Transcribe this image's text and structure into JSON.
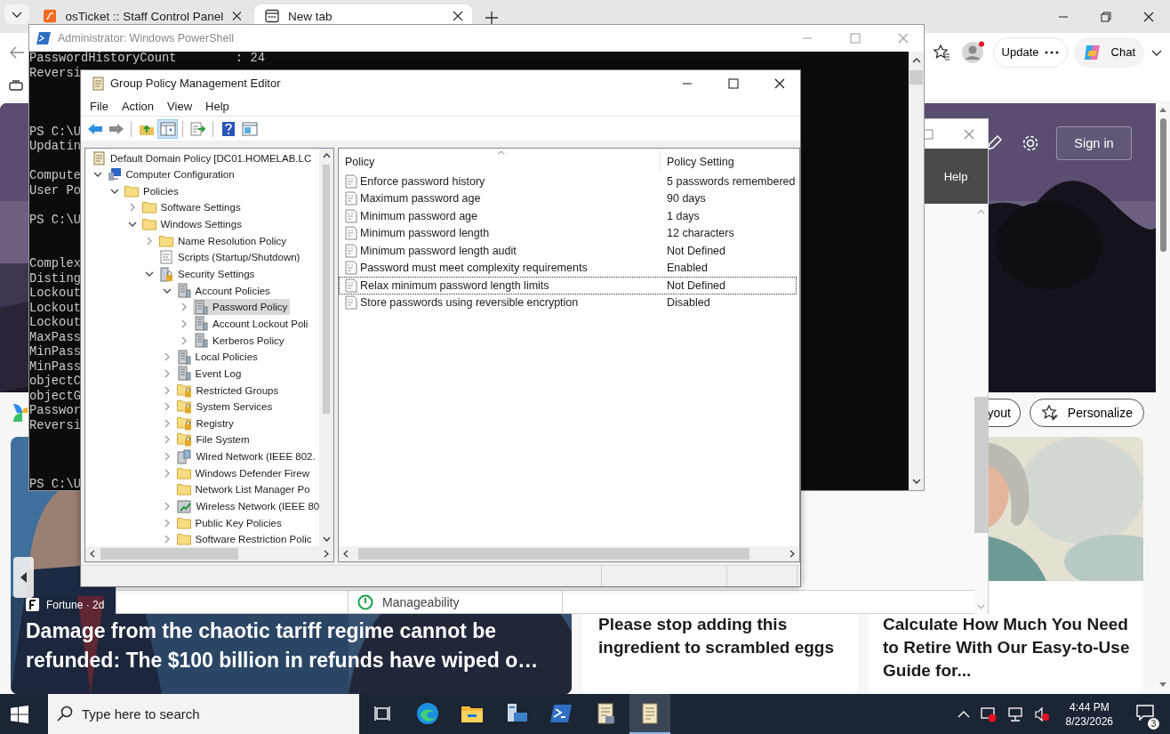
{
  "browser": {
    "tabs": [
      {
        "title": "osTicket :: Staff Control Panel",
        "selected": false
      },
      {
        "title": "New tab",
        "selected": true
      }
    ],
    "update_button": "Update",
    "chat_button": "Chat",
    "sign_in": "Sign in",
    "layout_button": "yout",
    "personalize_button": "Personalize",
    "cards": [
      {
        "kind": "photo-story",
        "source": "Fortune · 2d",
        "headline": "Damage from the chaotic tariff regime cannot be refunded: The $100 billion in refunds have wiped o…"
      },
      {
        "kind": "text-story",
        "headline": "Please stop adding this ingredient to scrambled eggs"
      },
      {
        "kind": "portrait-story",
        "headline": "Calculate How Much You Need to Retire With Our Easy-to-Use Guide for..."
      }
    ]
  },
  "background_window": {
    "menu_item": "Help",
    "row_label": "Manageability"
  },
  "powershell": {
    "title": "Administrator: Windows PowerShell",
    "blocks": [
      [
        "PasswordHistoryCount        : 24",
        "Reversi"
      ],
      [
        "PS C:\\U",
        "Updatin"
      ],
      [
        "Compute",
        "User Po"
      ],
      [
        "PS C:\\U"
      ],
      [
        "Complex",
        "Disting",
        "Lockout",
        "Lockout",
        "Lockout",
        "MaxPass",
        "MinPass",
        "MinPass",
        "objectC",
        "objectG",
        "Passwor",
        "Reversi"
      ],
      [
        "PS C:\\U"
      ]
    ]
  },
  "gpme": {
    "title": "Group Policy Management Editor",
    "menu": [
      "File",
      "Action",
      "View",
      "Help"
    ],
    "toolbar": [
      {
        "kind": "back",
        "pressed": false
      },
      {
        "kind": "forward",
        "pressed": false
      },
      {
        "kind": "up",
        "pressed": false
      },
      {
        "kind": "tree",
        "pressed": true
      },
      {
        "kind": "export",
        "pressed": false
      },
      {
        "kind": "help",
        "pressed": false
      },
      {
        "kind": "properties",
        "pressed": false
      }
    ],
    "tree": [
      {
        "label": "Default Domain Policy [DC01.HOMELAB.LC",
        "kind": "scroll",
        "selected": false,
        "children": [
          {
            "label": "Computer Configuration",
            "kind": "computer",
            "expanded": true,
            "selected": false,
            "children": [
              {
                "label": "Policies",
                "kind": "folder",
                "expanded": true,
                "selected": false,
                "children": [
                  {
                    "label": "Software Settings",
                    "kind": "folder",
                    "expanded": false,
                    "selected": false
                  },
                  {
                    "label": "Windows Settings",
                    "kind": "folder",
                    "expanded": true,
                    "selected": false,
                    "children": [
                      {
                        "label": "Name Resolution Policy",
                        "kind": "folder",
                        "expanded": false,
                        "selected": false
                      },
                      {
                        "label": "Scripts (Startup/Shutdown)",
                        "kind": "script",
                        "selected": false
                      },
                      {
                        "label": "Security Settings",
                        "kind": "security",
                        "expanded": true,
                        "selected": false,
                        "children": [
                          {
                            "label": "Account Policies",
                            "kind": "server",
                            "expanded": true,
                            "selected": false,
                            "children": [
                              {
                                "label": "Password Policy",
                                "kind": "server",
                                "expanded": false,
                                "selected": true
                              },
                              {
                                "label": "Account Lockout Poli",
                                "kind": "server",
                                "expanded": false,
                                "selected": false
                              },
                              {
                                "label": "Kerberos Policy",
                                "kind": "server",
                                "expanded": false,
                                "selected": false
                              }
                            ]
                          },
                          {
                            "label": "Local Policies",
                            "kind": "server",
                            "expanded": false,
                            "selected": false
                          },
                          {
                            "label": "Event Log",
                            "kind": "server",
                            "expanded": false,
                            "selected": false
                          },
                          {
                            "label": "Restricted Groups",
                            "kind": "folder-lock",
                            "expanded": false,
                            "selected": false
                          },
                          {
                            "label": "System Services",
                            "kind": "folder-lock",
                            "expanded": false,
                            "selected": false
                          },
                          {
                            "label": "Registry",
                            "kind": "folder-lock",
                            "expanded": false,
                            "selected": false
                          },
                          {
                            "label": "File System",
                            "kind": "folder-lock",
                            "expanded": false,
                            "selected": false
                          },
                          {
                            "label": "Wired Network (IEEE 802.",
                            "kind": "network",
                            "expanded": false,
                            "selected": false
                          },
                          {
                            "label": "Windows Defender Firew",
                            "kind": "folder",
                            "expanded": false,
                            "selected": false
                          },
                          {
                            "label": "Network List Manager Po",
                            "kind": "folder",
                            "selected": false
                          },
                          {
                            "label": "Wireless Network (IEEE 80",
                            "kind": "wireless",
                            "expanded": false,
                            "selected": false
                          },
                          {
                            "label": "Public Key Policies",
                            "kind": "folder",
                            "expanded": false,
                            "selected": false
                          },
                          {
                            "label": "Software Restriction Polic",
                            "kind": "folder",
                            "expanded": false,
                            "selected": false
                          }
                        ]
                      }
                    ]
                  }
                ]
              }
            ]
          }
        ]
      }
    ],
    "columns": [
      "Policy",
      "Policy Setting"
    ],
    "rows": [
      {
        "policy": "Enforce password history",
        "setting": "5 passwords remembered",
        "focused": false
      },
      {
        "policy": "Maximum password age",
        "setting": "90 days",
        "focused": false
      },
      {
        "policy": "Minimum password age",
        "setting": "1 days",
        "focused": false
      },
      {
        "policy": "Minimum password length",
        "setting": "12 characters",
        "focused": false
      },
      {
        "policy": "Minimum password length audit",
        "setting": "Not Defined",
        "focused": false
      },
      {
        "policy": "Password must meet complexity requirements",
        "setting": "Enabled",
        "focused": false
      },
      {
        "policy": "Relax minimum password length limits",
        "setting": "Not Defined",
        "focused": true
      },
      {
        "policy": "Store passwords using reversible encryption",
        "setting": "Disabled",
        "focused": false
      }
    ]
  },
  "taskbar": {
    "search_placeholder": "Type here to search",
    "apps": [
      {
        "kind": "task-view",
        "active": false
      },
      {
        "kind": "browser",
        "active": false
      },
      {
        "kind": "explorer",
        "active": false
      },
      {
        "kind": "server",
        "active": false
      },
      {
        "kind": "terminal",
        "active": false
      },
      {
        "kind": "scroll",
        "active": false
      },
      {
        "kind": "notes",
        "active": true
      }
    ],
    "time": "4:44 PM",
    "date": "8/23/2026",
    "notifications": "3"
  }
}
